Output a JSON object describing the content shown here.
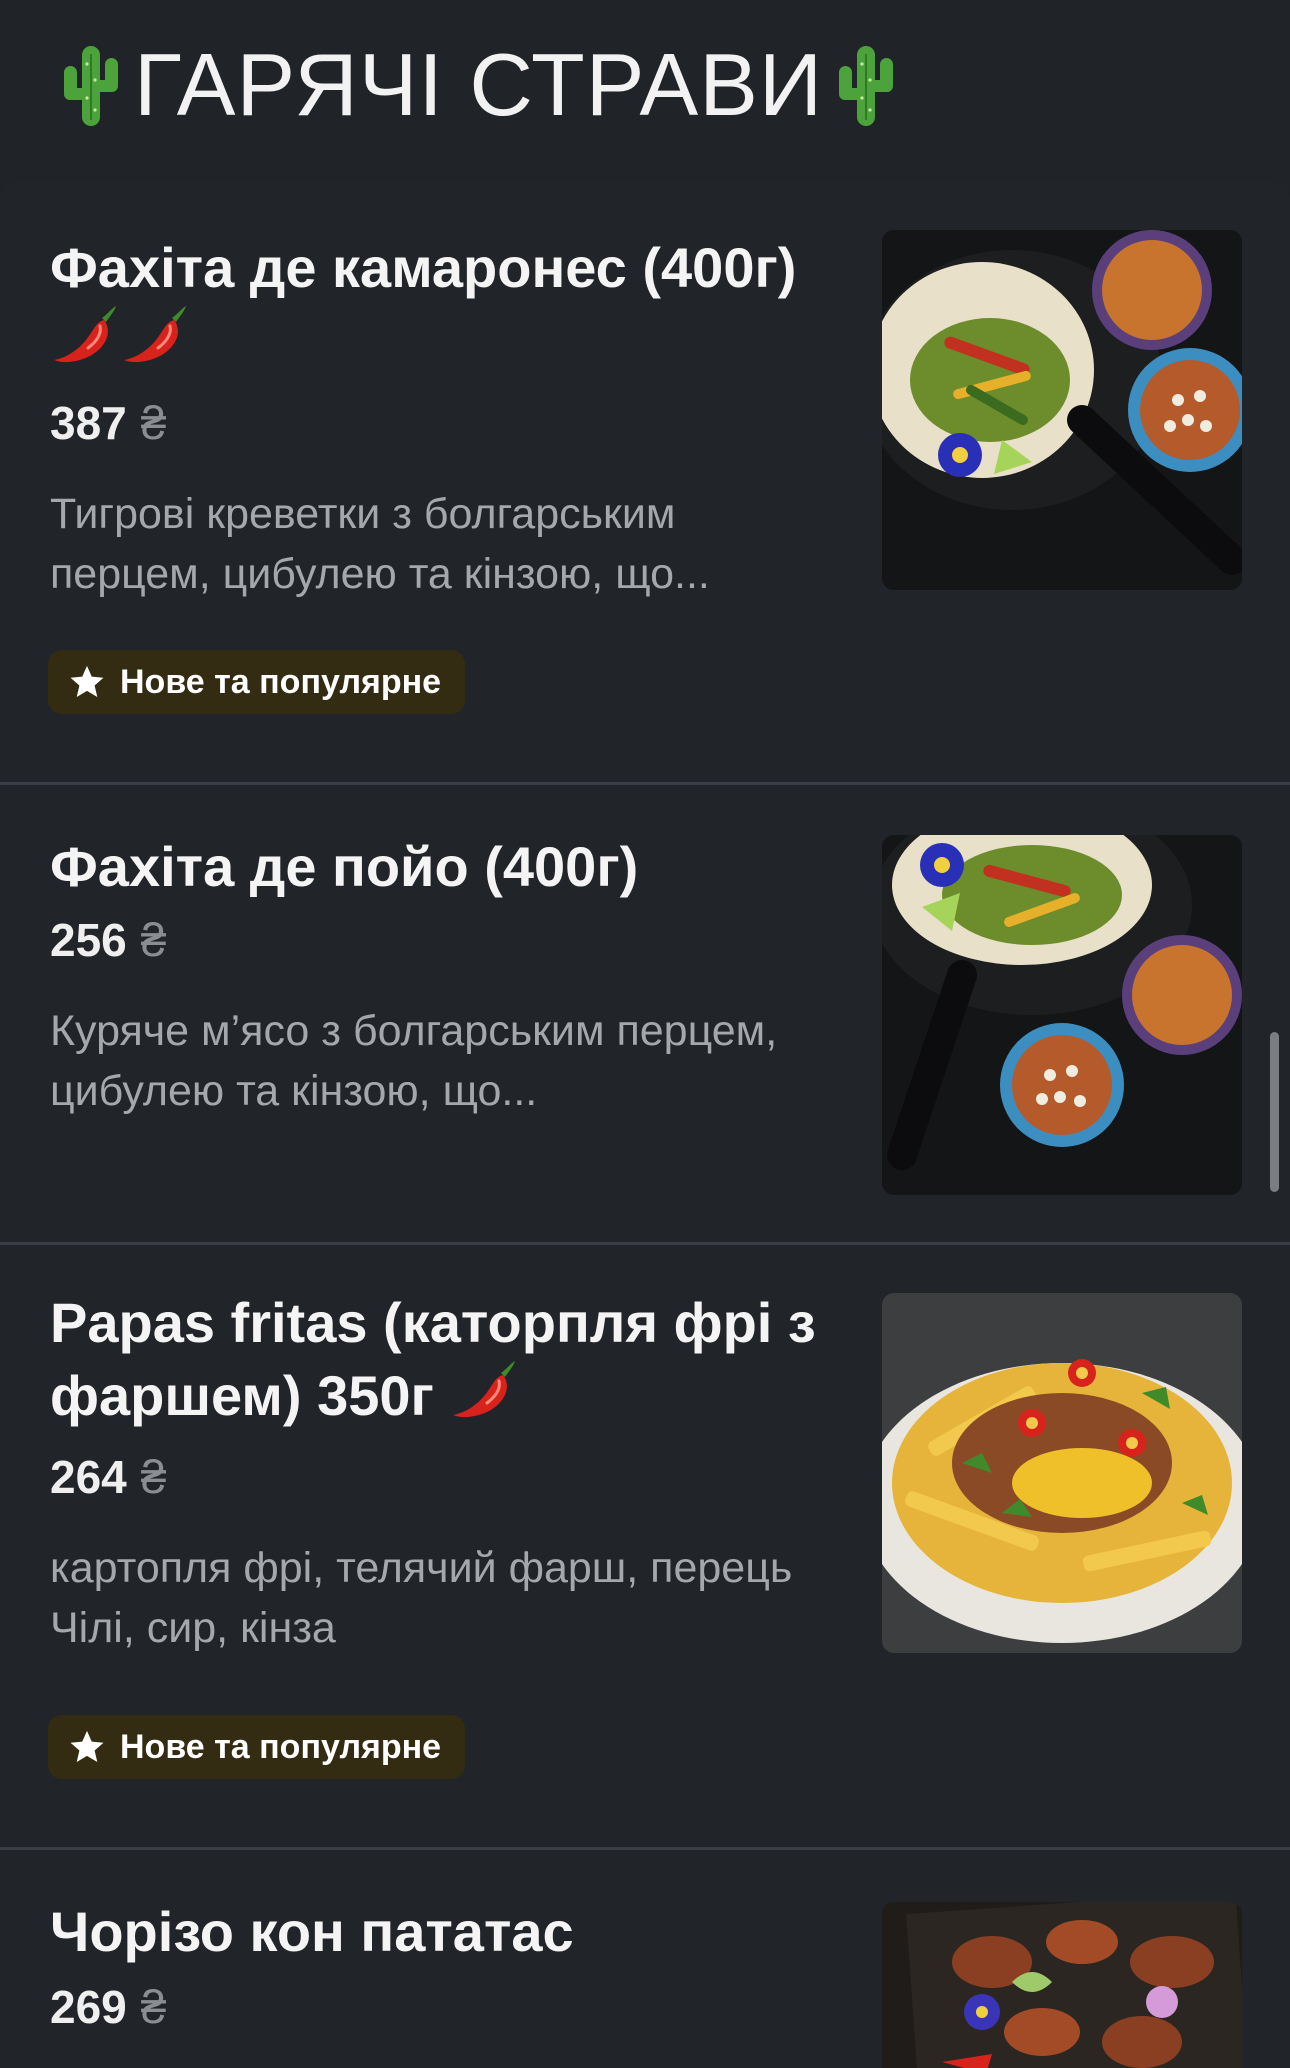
{
  "section": {
    "title": "ГАРЯЧІ СТРАВИ",
    "icon": "cactus-icon"
  },
  "items": [
    {
      "title": "Фахіта де камаронес (400г)",
      "spice_icons": [
        "chili-pepper-icon",
        "chili-pepper-icon"
      ],
      "price": "387",
      "currency": "₴",
      "description": "Тигрові креветки з болгарським перцем, цибулею та кінзою, що...",
      "badge": "Нове та популярне",
      "photo": "fajita-shrimp-photo"
    },
    {
      "title": "Фахіта де пойо (400г)",
      "price": "256",
      "currency": "₴",
      "description": "Куряче м’ясо з болгарським перцем, цибулею та кінзою, що...",
      "photo": "fajita-chicken-photo"
    },
    {
      "title": "Papas fritas (каторпля фрі з фаршем) 350г",
      "spice_icons": [
        "chili-pepper-icon"
      ],
      "price": "264",
      "currency": "₴",
      "description": "картопля фрі, телячий фарш, перець Чілі, сир, кінза",
      "badge": "Нове та популярне",
      "photo": "papas-fritas-photo"
    },
    {
      "title": "Чорізо кон пататас",
      "price": "269",
      "currency": "₴",
      "photo": "chorizo-potatoes-photo"
    }
  ],
  "colors": {
    "background": "#202327",
    "badge_bg": "#342c12",
    "text_secondary": "#a4a7ab",
    "divider": "#3a3e44"
  }
}
